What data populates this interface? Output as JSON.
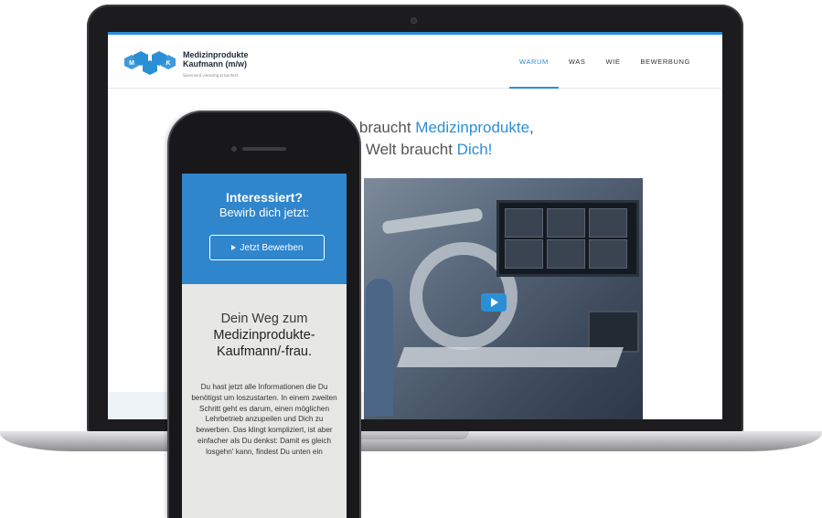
{
  "site": {
    "brand_line1": "Medizinprodukte",
    "brand_line2": "Kaufmann (m/w)",
    "tagline": "Spannend vielseitig krisenfest",
    "logo_letters": [
      "M",
      "P",
      "K"
    ],
    "nav": [
      {
        "label": "WARUM",
        "active": true
      },
      {
        "label": "WAS",
        "active": false
      },
      {
        "label": "WIE",
        "active": false
      },
      {
        "label": "BEWERBUNG",
        "active": false
      }
    ],
    "headline_pre1": "Die Welt braucht ",
    "headline_hl1": "Medizinprodukte",
    "headline_post1": ",",
    "headline_pre2": "Die Welt braucht ",
    "headline_hl2": "Dich!"
  },
  "mobile": {
    "cta_title": "Interessiert?",
    "cta_subtitle": "Bewirb dich jetzt:",
    "cta_button": "Jetzt Bewerben",
    "section_line1": "Dein Weg zum",
    "section_line2": "Medizinprodukte-",
    "section_line3": "Kaufmann/-frau.",
    "body": "Du hast jetzt alle Informationen die Du benötigst um loszustarten. In einem zweiten Schritt geht es darum, einen möglichen Lehrbetrieb anzupeilen und Dich zu bewerben. Das klingt kompliziert, ist aber einfacher als Du denkst: Damit es gleich losgehn' kann, findest Du unten ein"
  },
  "colors": {
    "accent": "#2b8fd6",
    "cta_bg": "#2f86cc",
    "phone_bg": "#e7e7e6"
  },
  "icons": [
    "play-icon",
    "triangle-right-icon",
    "hexagon-logo-icon"
  ]
}
